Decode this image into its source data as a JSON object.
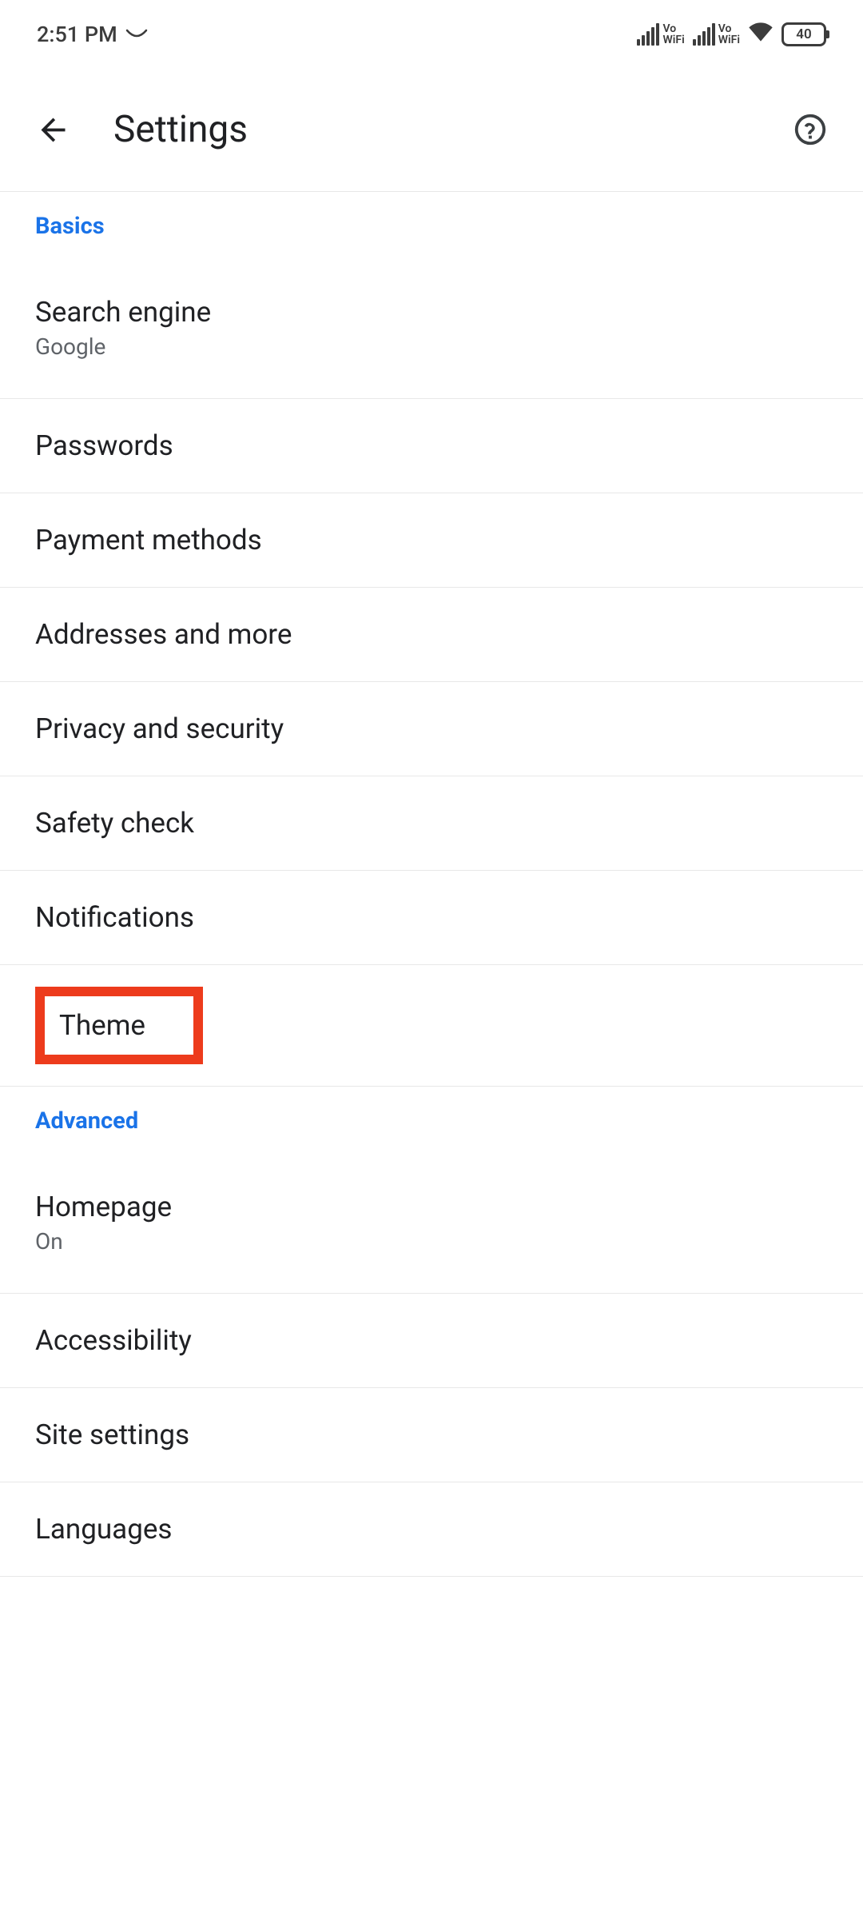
{
  "status": {
    "time": "2:51 PM",
    "battery": "40",
    "vowifi1": "Vo\nWiFi",
    "vowifi2": "Vo\nWiFi"
  },
  "header": {
    "title": "Settings"
  },
  "sections": {
    "basics_label": "Basics",
    "advanced_label": "Advanced"
  },
  "items": {
    "search_engine": {
      "title": "Search engine",
      "subtitle": "Google"
    },
    "passwords": {
      "title": "Passwords"
    },
    "payment": {
      "title": "Payment methods"
    },
    "addresses": {
      "title": "Addresses and more"
    },
    "privacy": {
      "title": "Privacy and security"
    },
    "safety": {
      "title": "Safety check"
    },
    "notifications": {
      "title": "Notifications"
    },
    "theme": {
      "title": "Theme"
    },
    "homepage": {
      "title": "Homepage",
      "subtitle": "On"
    },
    "accessibility": {
      "title": "Accessibility"
    },
    "site_settings": {
      "title": "Site settings"
    },
    "languages": {
      "title": "Languages"
    }
  },
  "highlight": {
    "target": "theme",
    "color": "#ed3b1c"
  }
}
